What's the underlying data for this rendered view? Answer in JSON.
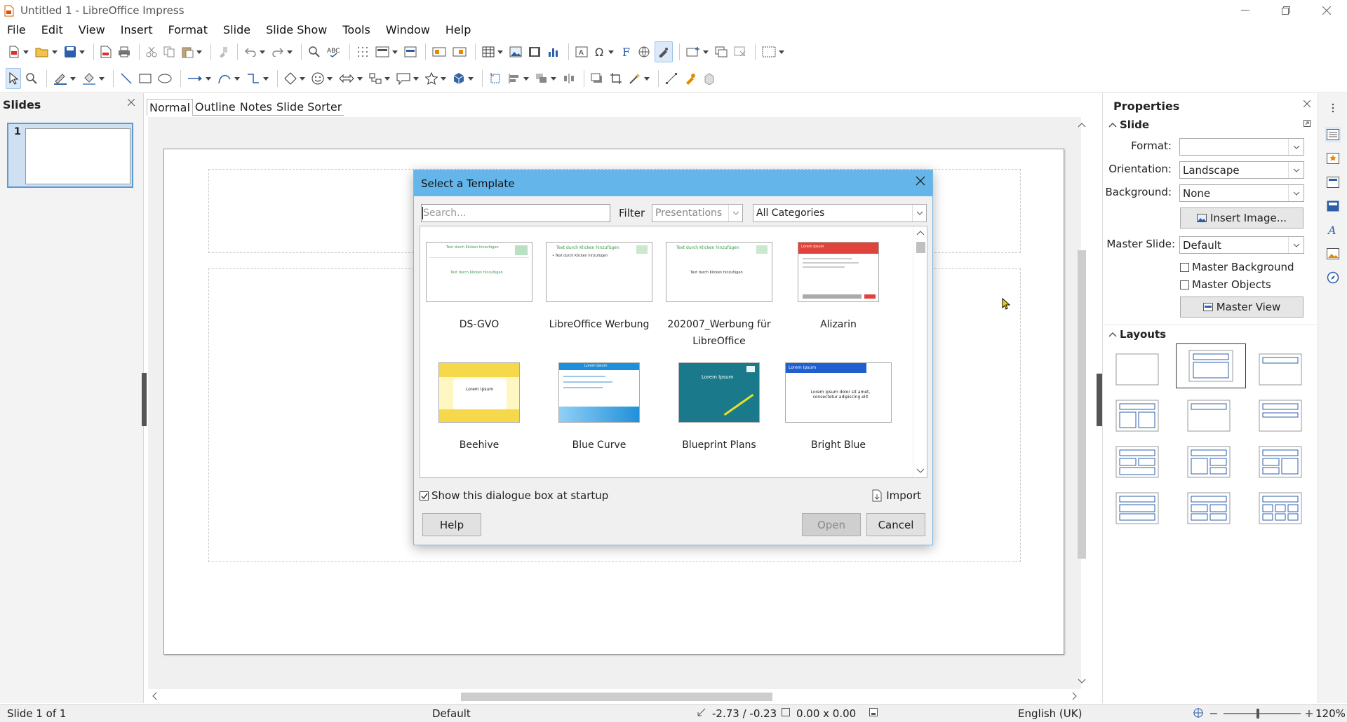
{
  "window": {
    "title": "Untitled 1 - LibreOffice Impress"
  },
  "menu": [
    "File",
    "Edit",
    "View",
    "Insert",
    "Format",
    "Slide",
    "Slide Show",
    "Tools",
    "Window",
    "Help"
  ],
  "slides_pane": {
    "title": "Slides",
    "slide_number": "1"
  },
  "view_tabs": [
    "Normal",
    "Outline",
    "Notes",
    "Slide Sorter"
  ],
  "properties": {
    "title": "Properties",
    "slide_section": "Slide",
    "format_label": "Format:",
    "format_value": "",
    "orientation_label": "Orientation:",
    "orientation_value": "Landscape",
    "background_label": "Background:",
    "background_value": "None",
    "insert_image": "Insert Image...",
    "master_slide_label": "Master Slide:",
    "master_slide_value": "Default",
    "master_background": "Master Background",
    "master_objects": "Master Objects",
    "master_view": "Master View",
    "layouts_section": "Layouts"
  },
  "dialog": {
    "title": "Select a Template",
    "search_placeholder": "Search...",
    "filter_label": "Filter",
    "filter_value": "Presentations",
    "category_value": "All Categories",
    "templates": [
      {
        "name": "DS-GVO",
        "thumb_text": "Text durch Klicken hinzufügen"
      },
      {
        "name": "LibreOffice Werbung",
        "thumb_text": "Text durch Klicken hinzufügen"
      },
      {
        "name": "202007_Werbung für LibreOffice",
        "thumb_text": "Text durch Klicken hinzufügen"
      },
      {
        "name": "Alizarin",
        "thumb_text": "Lorem Ipsum"
      },
      {
        "name": "Beehive",
        "thumb_text": "Lorem Ipsum"
      },
      {
        "name": "Blue Curve",
        "thumb_text": "Lorem Ipsum"
      },
      {
        "name": "Blueprint Plans",
        "thumb_text": "Lorem Ipsum"
      },
      {
        "name": "Bright Blue",
        "thumb_text": "Lorem ipsum dolor sit amet, consectetur adipiscing elit"
      }
    ],
    "show_at_startup": "Show this dialogue box at startup",
    "import": "Import",
    "help": "Help",
    "open": "Open",
    "cancel": "Cancel"
  },
  "status": {
    "slide": "Slide 1 of 1",
    "master": "Default",
    "position": "-2.73 / -0.23",
    "size": "0.00 x 0.00",
    "language": "English (UK)",
    "zoom": "120%"
  },
  "colors": {
    "dialog_title": "#64b5ea",
    "selection": "#5b9bd5"
  }
}
